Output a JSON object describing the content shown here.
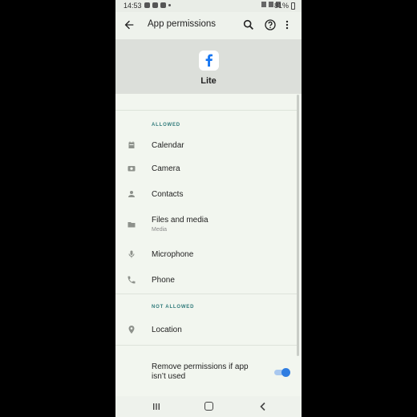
{
  "status_bar": {
    "time": "14:53",
    "battery": "81%"
  },
  "toolbar": {
    "title": "App permissions"
  },
  "app": {
    "name": "Lite"
  },
  "sections": {
    "allowed_label": "ALLOWED",
    "not_allowed_label": "NOT ALLOWED"
  },
  "allowed": [
    {
      "label": "Calendar",
      "icon": "calendar-icon"
    },
    {
      "label": "Camera",
      "icon": "camera-icon"
    },
    {
      "label": "Contacts",
      "icon": "person-icon"
    },
    {
      "label": "Files and media",
      "sub": "Media",
      "icon": "folder-icon"
    },
    {
      "label": "Microphone",
      "icon": "microphone-icon"
    },
    {
      "label": "Phone",
      "icon": "phone-icon"
    }
  ],
  "not_allowed": [
    {
      "label": "Location",
      "icon": "location-pin-icon"
    }
  ],
  "remove_permissions": {
    "label": "Remove permissions if app isn’t used",
    "enabled": true
  },
  "colors": {
    "accent": "#2f7de1",
    "section_label": "#2f7a7a",
    "facebook_blue": "#1877f2"
  }
}
